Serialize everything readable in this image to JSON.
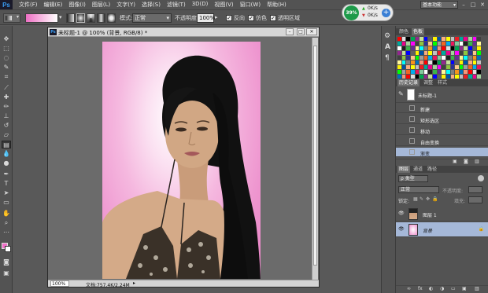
{
  "app": {
    "logo": "Ps"
  },
  "menus": [
    "文件(F)",
    "编辑(E)",
    "图像(I)",
    "图层(L)",
    "文字(Y)",
    "选择(S)",
    "滤镜(T)",
    "3D(D)",
    "视图(V)",
    "窗口(W)",
    "帮助(H)"
  ],
  "workspace": {
    "value": "基本功能"
  },
  "options": {
    "mode_label": "模式:",
    "mode_value": "正常",
    "opacity_label": "不透明度:",
    "opacity_value": "100%",
    "reverse_label": "反向",
    "dither_label": "仿色",
    "transparency_label": "透明区域"
  },
  "perf": {
    "percent": "39%",
    "up": "0K/s",
    "down": "0K/s"
  },
  "document": {
    "tab_title": "未标题-1 @ 100% (背景, RGB/8) *",
    "zoom": "100%",
    "doc_size": "文档:757.4K/2.24M"
  },
  "swatches_panel": {
    "tabs": [
      "颜色",
      "色板"
    ],
    "active": 1
  },
  "history_panel": {
    "tabs": [
      "历史记录",
      "调整",
      "样式"
    ],
    "snapshot": "未标题-1",
    "items": [
      "新建",
      "矩形选区",
      "移动",
      "自由变换",
      "渐变"
    ],
    "active_index": 4
  },
  "layers_panel": {
    "tabs": [
      "图层",
      "通道",
      "路径"
    ],
    "filter_label": "ρ 类型",
    "blend_value": "正常",
    "opacity_label": "不透明度:",
    "lock_label": "锁定:",
    "fill_label": "填充:",
    "layers": [
      {
        "name": "图层 1",
        "selected": false
      },
      {
        "name": "背景",
        "selected": true
      }
    ]
  },
  "colors": {
    "accent": "#3a9cf3",
    "selected_row": "#a5b8d8",
    "panel": "#535353"
  }
}
